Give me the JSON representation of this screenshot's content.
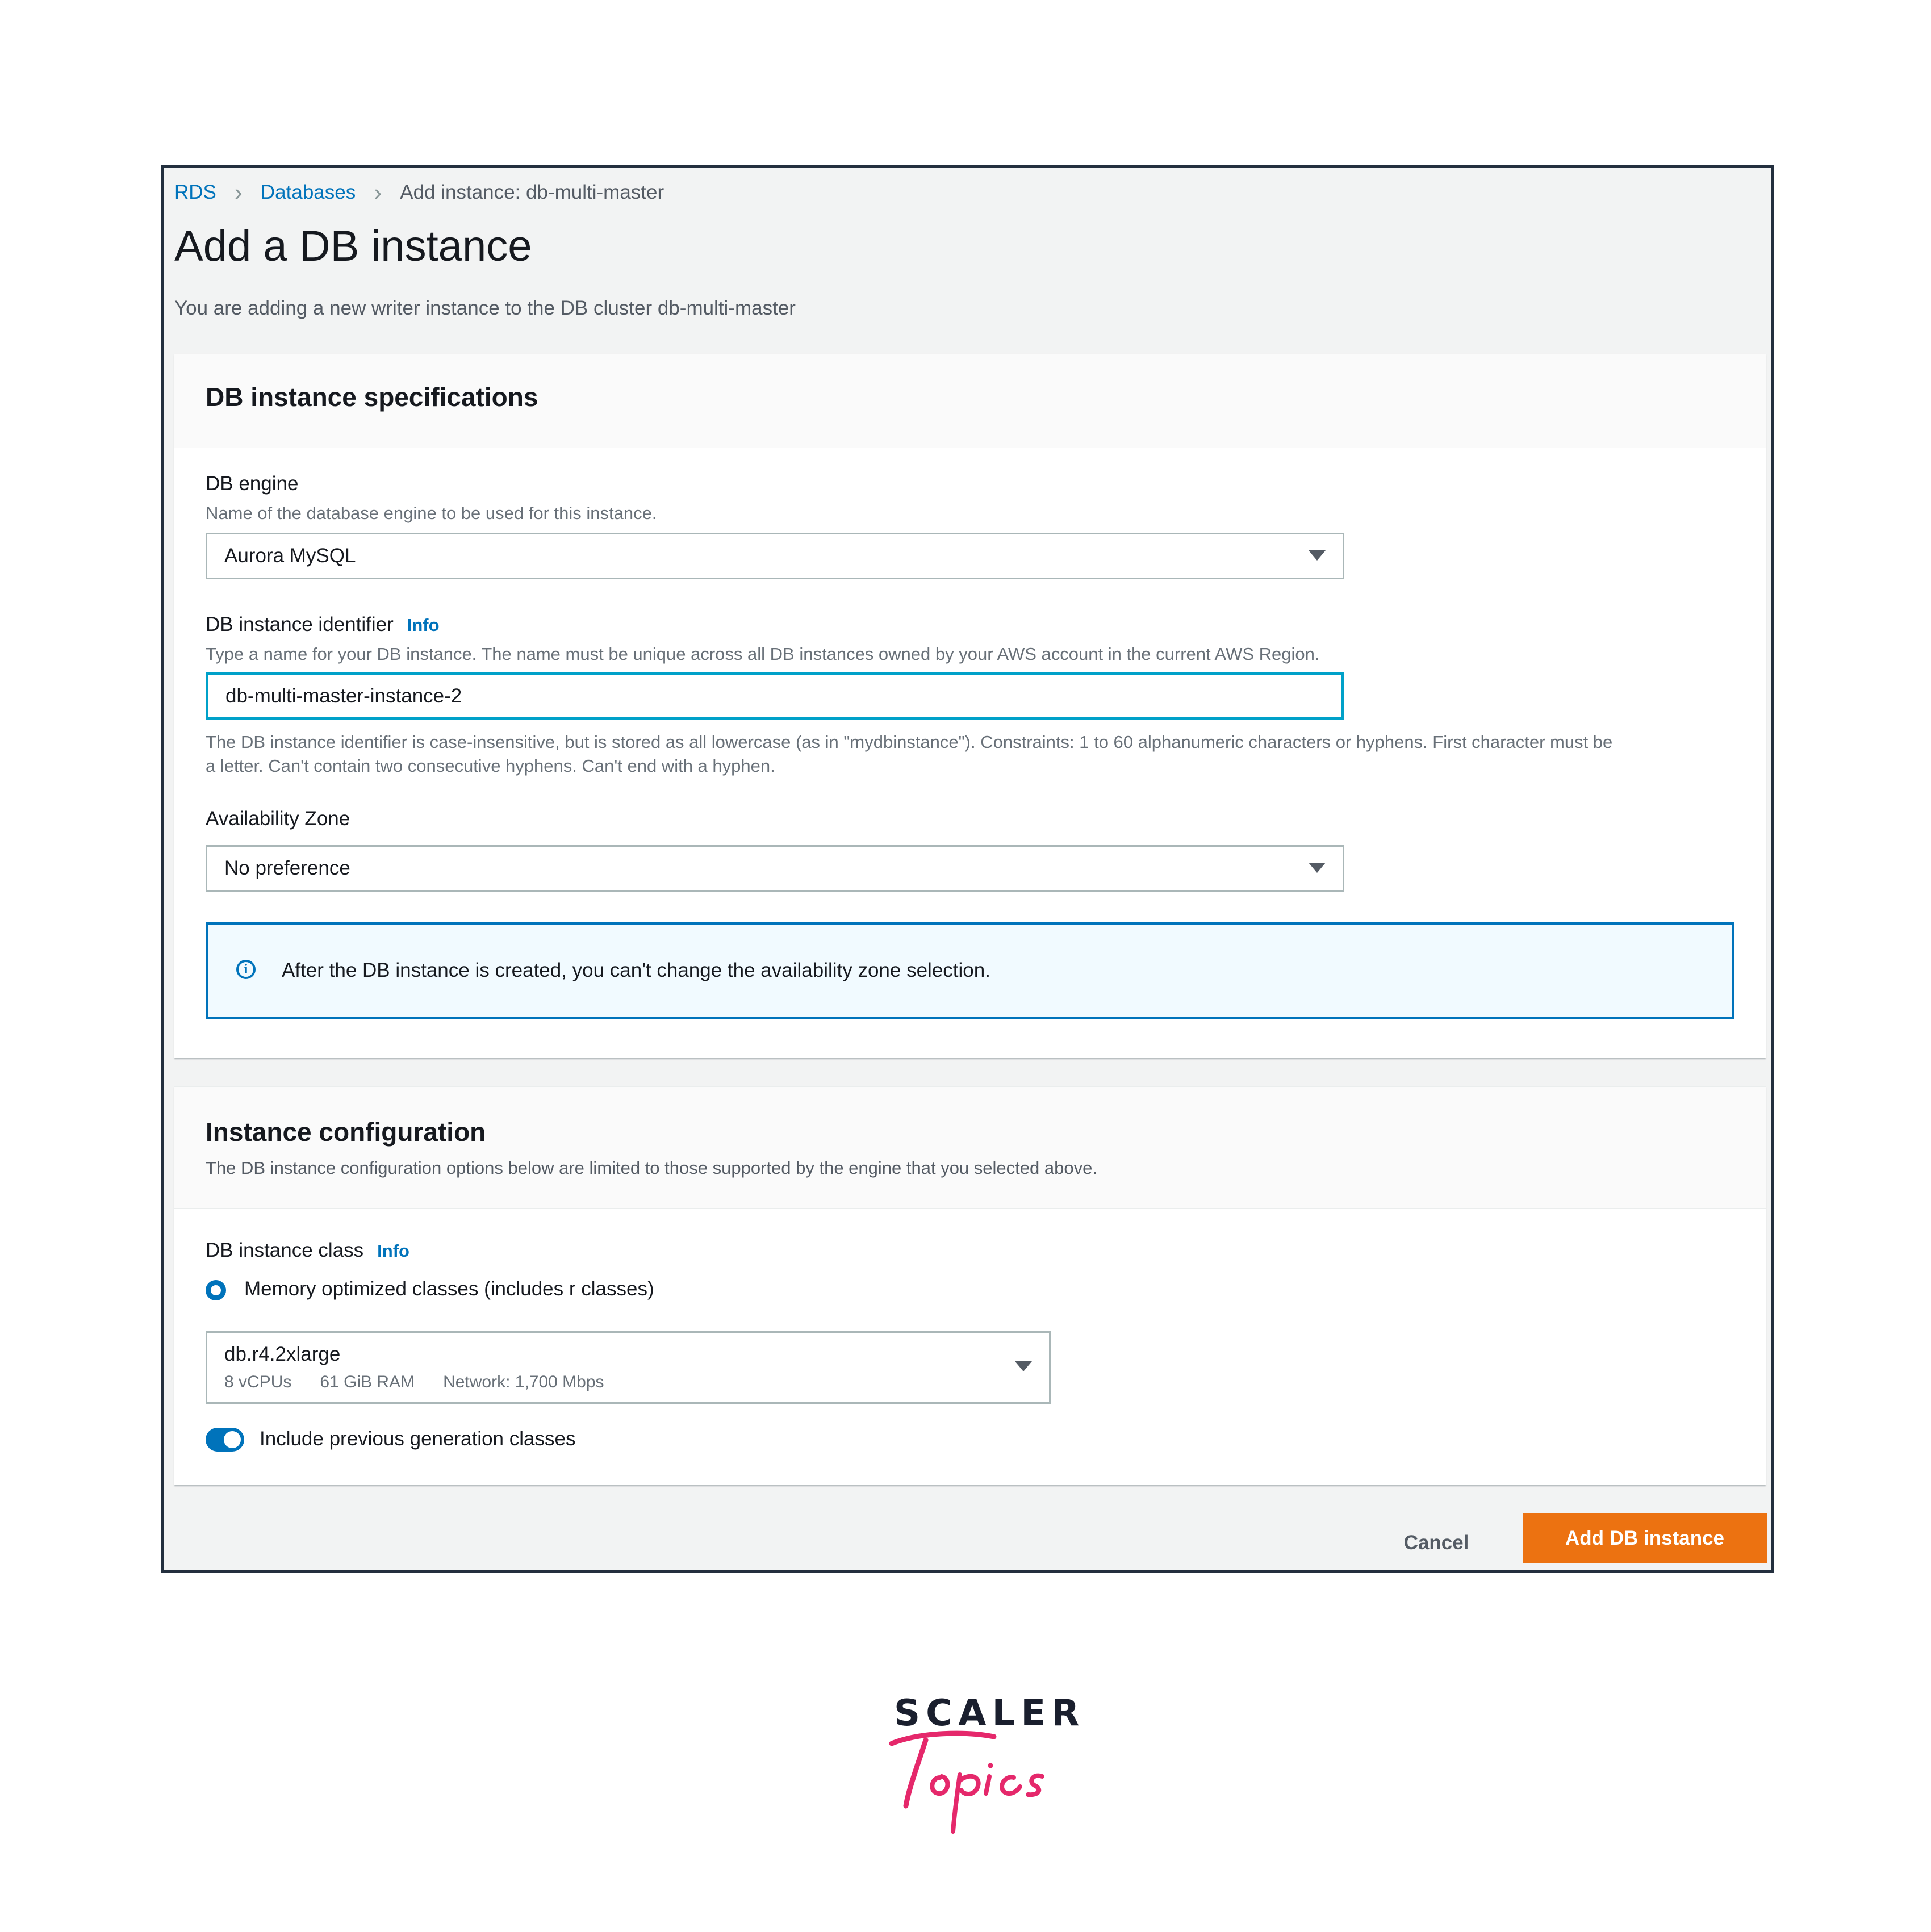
{
  "breadcrumb": {
    "root": "RDS",
    "parent": "Databases",
    "current": "Add instance: db-multi-master"
  },
  "page": {
    "title": "Add a DB instance",
    "subtitle": "You are adding a new writer instance to the DB cluster db-multi-master"
  },
  "specs": {
    "title": "DB instance specifications",
    "engine_label": "DB engine",
    "engine_desc": "Name of the database engine to be used for this instance.",
    "engine_value": "Aurora MySQL",
    "identifier_label": "DB instance identifier",
    "info": "Info",
    "identifier_desc": "Type a name for your DB instance. The name must be unique across all DB instances owned by your AWS account in the current AWS Region.",
    "identifier_value": "db-multi-master-instance-2",
    "identifier_constraint_1": "The DB instance identifier is case-insensitive, but is stored as all lowercase (as in \"mydbinstance\"). Constraints: 1 to 60 alphanumeric characters or hyphens. First character must be",
    "identifier_constraint_2": "a letter. Can't contain two consecutive hyphens. Can't end with a hyphen.",
    "az_label": "Availability Zone",
    "az_value": "No preference",
    "alert_text": "After the DB instance is created, you can't change the availability zone selection."
  },
  "config": {
    "title": "Instance configuration",
    "desc": "The DB instance configuration options below are limited to those supported by the engine that you selected above.",
    "class_label": "DB instance class",
    "info": "Info",
    "radio_label": "Memory optimized classes (includes r classes)",
    "class_value": "db.r4.2xlarge",
    "class_vcpu": "8 vCPUs",
    "class_ram": "61 GiB RAM",
    "class_network": "Network: 1,700 Mbps",
    "toggle_label": "Include previous generation classes"
  },
  "actions": {
    "cancel": "Cancel",
    "submit": "Add DB instance"
  },
  "colors": {
    "accent": "#0073bb",
    "primary_button": "#ec7211",
    "focus": "#00a1c9",
    "logo_pink": "#e5286b"
  },
  "branding": {
    "logo_text_top": "SCALER",
    "logo_text_bottom": "Topics"
  }
}
